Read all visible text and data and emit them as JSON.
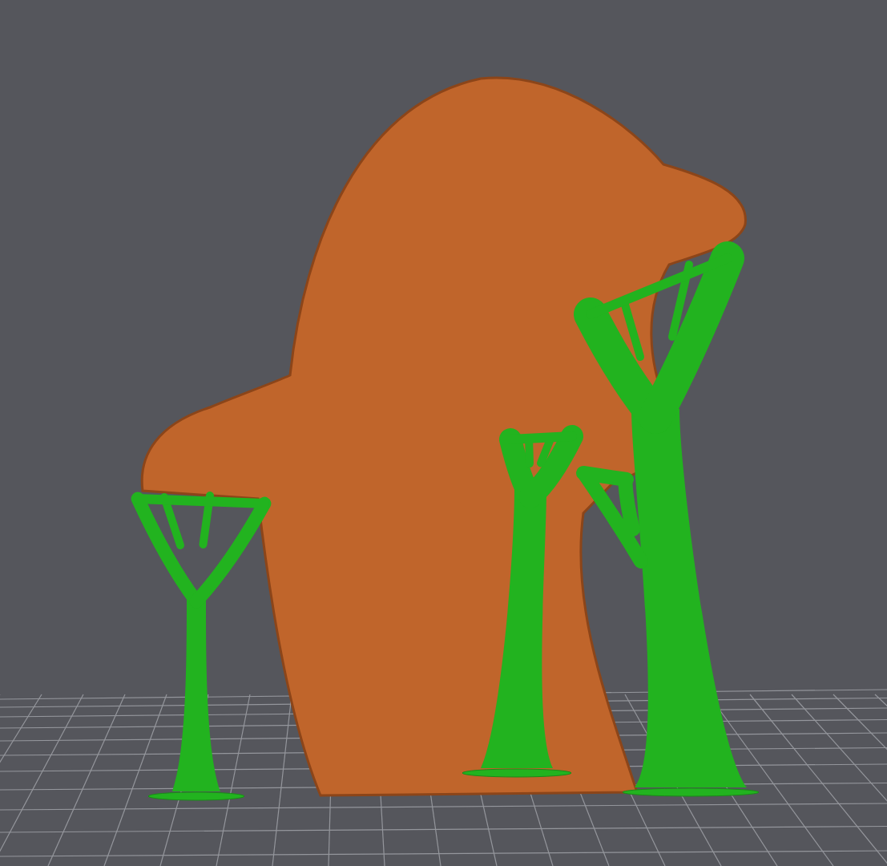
{
  "viewport": {
    "objects": [
      {
        "kind": "model",
        "color": "#c0652b"
      },
      {
        "kind": "support",
        "color": "#22b31f"
      },
      {
        "kind": "support",
        "color": "#22b31f"
      },
      {
        "kind": "support",
        "color": "#22b31f"
      }
    ]
  }
}
